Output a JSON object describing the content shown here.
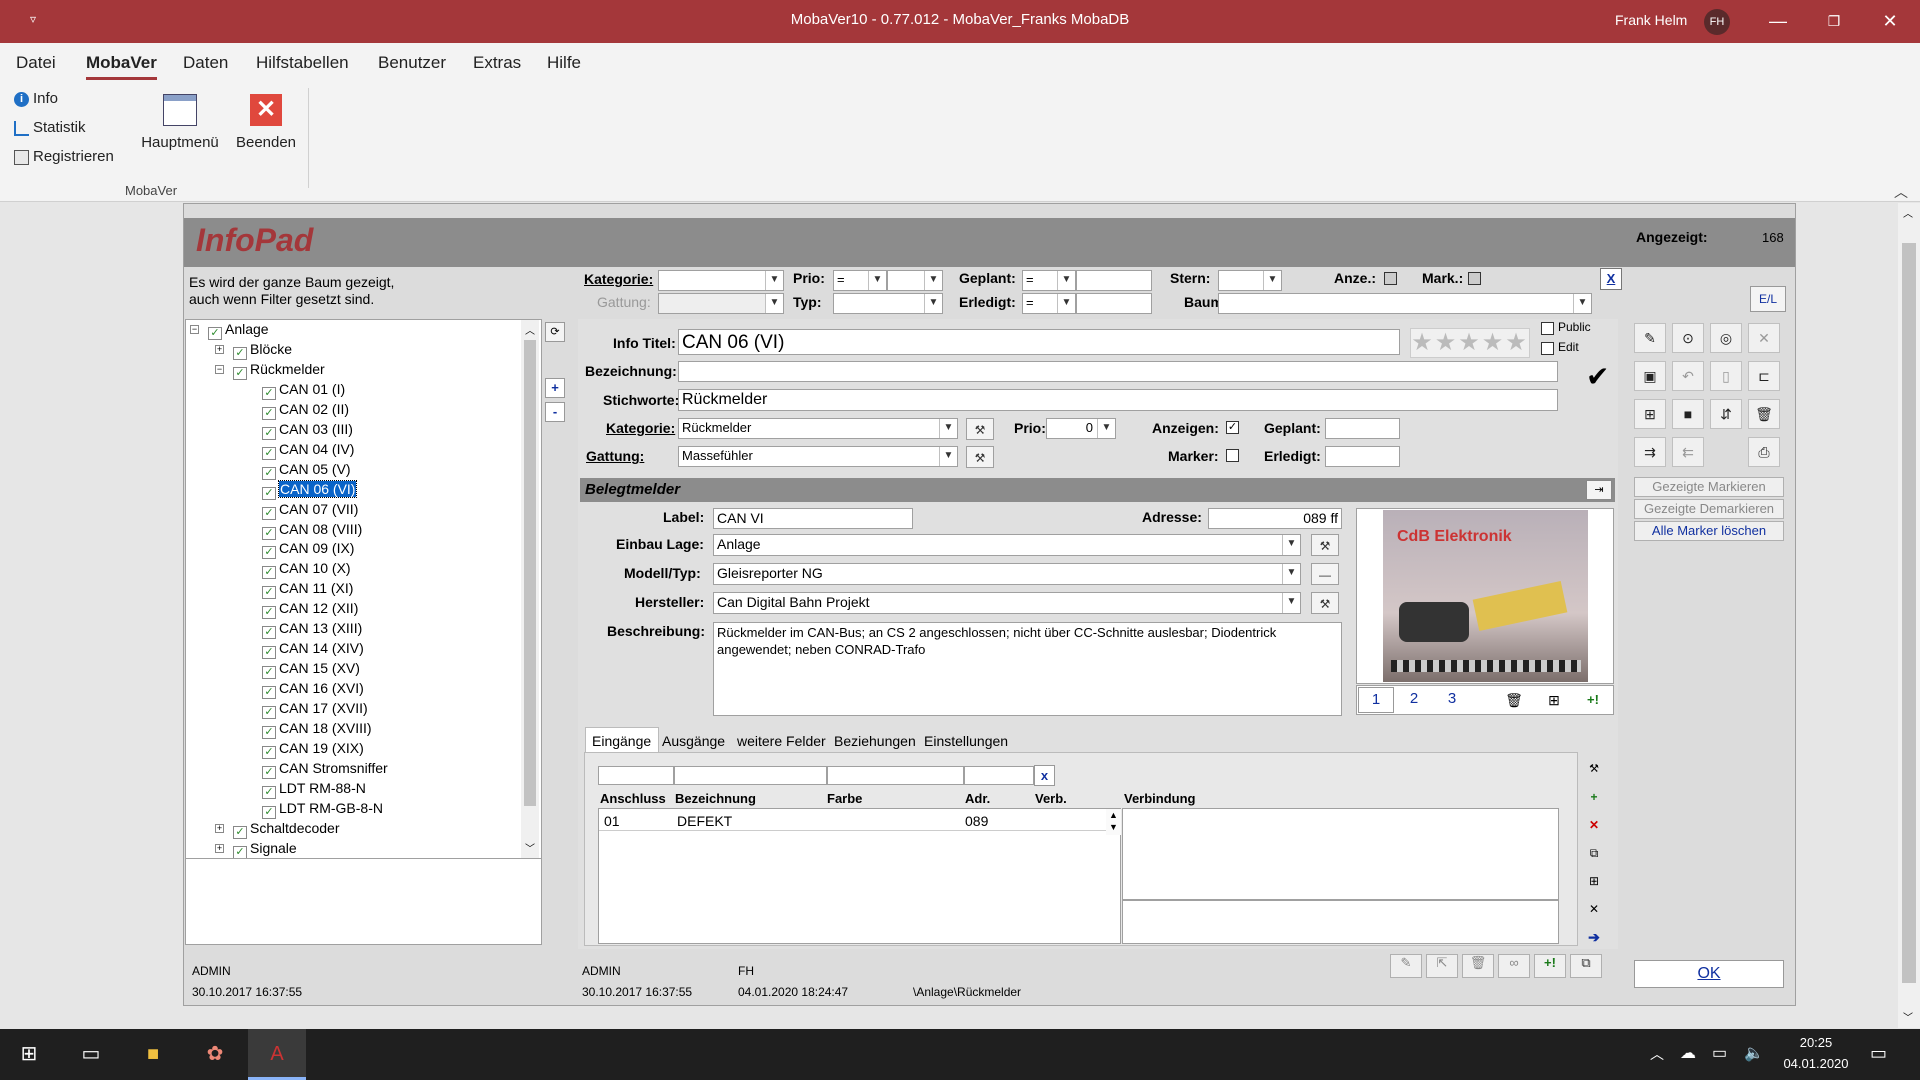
{
  "window": {
    "title": "MobaVer10 - 0.77.012 - MobaVer_Franks MobaDB",
    "user": "Frank Helm",
    "user_initials": "FH"
  },
  "menu": [
    "Datei",
    "MobaVer",
    "Daten",
    "Hilfstabellen",
    "Benutzer",
    "Extras",
    "Hilfe"
  ],
  "ribbon": {
    "items": [
      "Info",
      "Statistik",
      "Registrieren"
    ],
    "hauptmenu": "Hauptmenü",
    "beenden": "Beenden",
    "group": "MobaVer"
  },
  "form": {
    "title": "InfoPad",
    "angezeigt_label": "Angezeigt:",
    "angezeigt_value": "168",
    "hint": "Es wird der ganze Baum gezeigt, auch wenn Filter gesetzt sind.",
    "filter": {
      "kategorie": "Kategorie:",
      "gattung": "Gattung:",
      "prio": "Prio:",
      "prio_op": "=",
      "typ": "Typ:",
      "geplant": "Geplant:",
      "geplant_op": "=",
      "erledigt": "Erledigt:",
      "erledigt_op": "=",
      "stern": "Stern:",
      "anze": "Anze.:",
      "mark": "Mark.:",
      "baum": "Baum:",
      "clear": "X",
      "el": "E/L"
    }
  },
  "tree": {
    "root": "Anlage",
    "groups": [
      "Blöcke",
      "Rückmelder"
    ],
    "items": [
      "CAN 01 (I)",
      "CAN 02 (II)",
      "CAN 03 (III)",
      "CAN 04 (IV)",
      "CAN 05 (V)",
      "CAN 06 (VI)",
      "CAN 07 (VII)",
      "CAN 08 (VIII)",
      "CAN 09 (IX)",
      "CAN 10 (X)",
      "CAN 11 (XI)",
      "CAN 12 (XII)",
      "CAN 13 (XIII)",
      "CAN 14 (XIV)",
      "CAN 15 (XV)",
      "CAN 16 (XVI)",
      "CAN 17 (XVII)",
      "CAN 18 (XVIII)",
      "CAN 19 (XIX)",
      "CAN Stromsniffer",
      "LDT RM-88-N",
      "LDT RM-GB-8-N"
    ],
    "after": [
      "Schaltdecoder",
      "Signale"
    ],
    "selected": "CAN 06 (VI)",
    "plus": "+",
    "minus": "-"
  },
  "detail": {
    "info_titel_label": "Info Titel:",
    "info_titel": "CAN 06 (VI)",
    "bezeichnung_label": "Bezeichnung:",
    "bezeichnung": "",
    "stichworte_label": "Stichworte:",
    "stichworte": "Rückmelder",
    "kategorie_label": "Kategorie:",
    "kategorie": "Rückmelder",
    "gattung_label": "Gattung:",
    "gattung": "Massefühler",
    "prio_label": "Prio:",
    "prio": "0",
    "anzeigen_label": "Anzeigen:",
    "marker_label": "Marker:",
    "geplant_label": "Geplant:",
    "erledigt_label": "Erledigt:",
    "public": "Public",
    "edit": "Edit",
    "stars": "★★★★★"
  },
  "beleg": {
    "title": "Belegtmelder",
    "label_label": "Label:",
    "label": "CAN VI",
    "adresse_label": "Adresse:",
    "adresse": "089 ff",
    "einbau_label": "Einbau Lage:",
    "einbau": "Anlage",
    "modell_label": "Modell/Typ:",
    "modell": "Gleisreporter NG",
    "hersteller_label": "Hersteller:",
    "hersteller": "Can Digital Bahn Projekt",
    "beschreibung_label": "Beschreibung:",
    "beschreibung": "Rückmelder im CAN-Bus; an CS 2 angeschlossen; nicht über CC-Schnitte auslesbar; Diodentrick angewendet; neben CONRAD-Trafo",
    "img_pages": [
      "1",
      "2",
      "3"
    ],
    "img_text": "CdB Elektronik"
  },
  "tabs": [
    "Eingänge",
    "Ausgänge",
    "weitere Felder",
    "Beziehungen",
    "Einstellungen"
  ],
  "inputs": {
    "headers": [
      "Anschluss",
      "Bezeichnung",
      "Farbe",
      "Adr.",
      "Verb."
    ],
    "verbindung_header": "Verbindung",
    "filter_clear": "x",
    "rows": [
      {
        "anschluss": "01",
        "bezeichnung": "DEFEKT",
        "farbe": "",
        "adr": "089",
        "verb": ""
      }
    ]
  },
  "right": {
    "markieren": "Gezeigte Markieren",
    "demarkieren": "Gezeigte Demarkieren",
    "loeschen": "Alle Marker löschen",
    "ok": "OK"
  },
  "footer": {
    "left_user": "ADMIN",
    "left_date": "30.10.2017 16:37:55",
    "user": "ADMIN",
    "created": "30.10.2017 16:37:55",
    "mod_user": "FH",
    "modified": "04.01.2020 18:24:47",
    "path": "\\Anlage\\Rückmelder"
  },
  "taskbar": {
    "time": "20:25",
    "date": "04.01.2020"
  },
  "colors": {
    "title_bar": "#a4373a",
    "header_gray": "#8c8c8c",
    "selected": "#0a64c8"
  }
}
